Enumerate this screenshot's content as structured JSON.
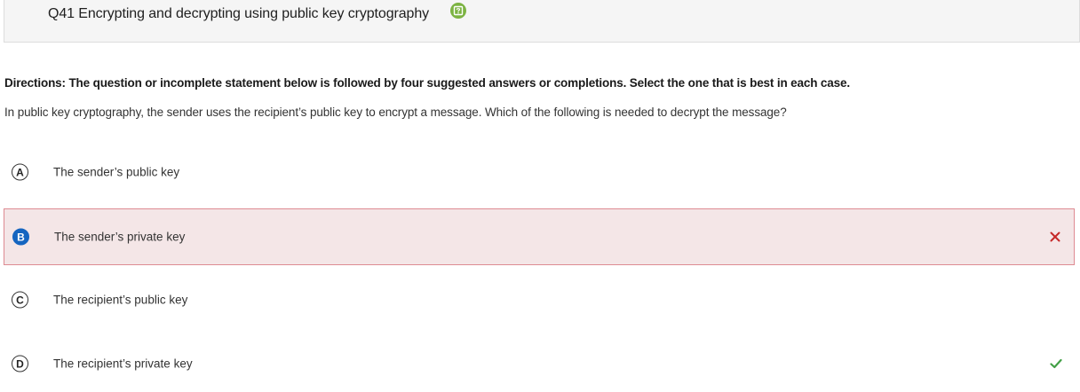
{
  "question": {
    "title": "Q41 Encrypting and decrypting using public key cryptography",
    "directions": "Directions: The question or incomplete statement below is followed by four suggested answers or completions. Select the one that is best in each case.",
    "text": "In public key cryptography, the sender uses the recipient’s public key to encrypt a message. Which of the following is needed to decrypt the message?"
  },
  "options": [
    {
      "letter": "A",
      "text": "The sender’s public key"
    },
    {
      "letter": "B",
      "text": "The sender’s private key"
    },
    {
      "letter": "C",
      "text": "The recipient’s public key"
    },
    {
      "letter": "D",
      "text": "The recipient’s private key"
    }
  ],
  "state": {
    "selected": "B",
    "incorrect": "B",
    "correct": "D"
  },
  "icons": {
    "help": "help-icon",
    "incorrect": "close-icon",
    "correct": "checkmark-icon"
  },
  "colors": {
    "help_badge": "#7cb342",
    "selected_letter": "#1565c0",
    "wrong_bg": "#f4e6e7",
    "wrong_border": "#de8b92",
    "wrong_mark": "#c62828",
    "correct_mark": "#43a047"
  }
}
